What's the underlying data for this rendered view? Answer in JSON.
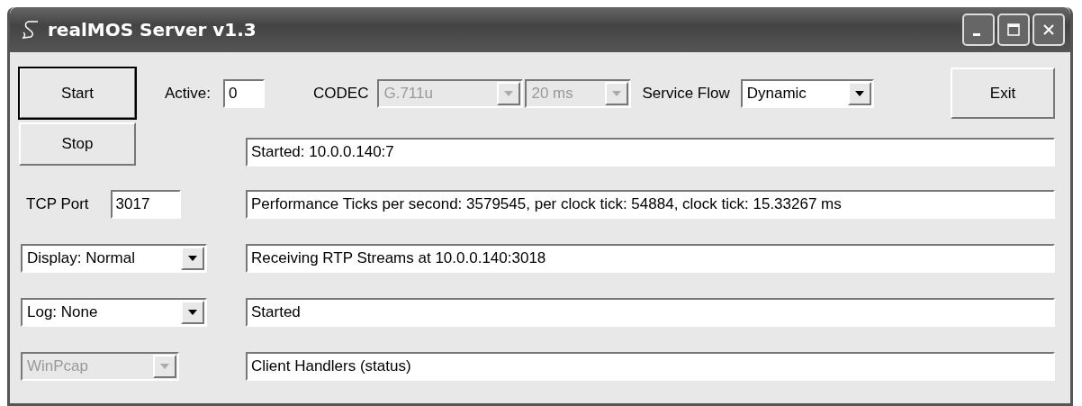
{
  "window": {
    "title": "realMOS Server v1.3"
  },
  "buttons": [
    {
      "label": "Start",
      "focused": true
    },
    {
      "label": "Stop",
      "focused": false
    },
    {
      "label": "Exit",
      "focused": false
    }
  ],
  "active": {
    "label": "Active:",
    "value": "0"
  },
  "codec": {
    "label": "CODEC",
    "selects": [
      {
        "value": "G.711u",
        "disabled": true
      },
      {
        "value": "20 ms",
        "disabled": true
      }
    ]
  },
  "service_flow": {
    "label": "Service Flow",
    "value": "Dynamic",
    "disabled": false
  },
  "tcp_port": {
    "label": "TCP Port",
    "value": "3017"
  },
  "left_selects": [
    {
      "value": "Display: Normal",
      "disabled": false
    },
    {
      "value": "Log: None",
      "disabled": false
    },
    {
      "value": "WinPcap",
      "disabled": true
    }
  ],
  "status_fields": [
    "Started: 10.0.0.140:7",
    "Performance Ticks per second: 3579545, per clock tick: 54884, clock tick: 15.33267 ms",
    "Receiving RTP Streams at 10.0.0.140:3018",
    "Started",
    "Client Handlers (status)"
  ]
}
